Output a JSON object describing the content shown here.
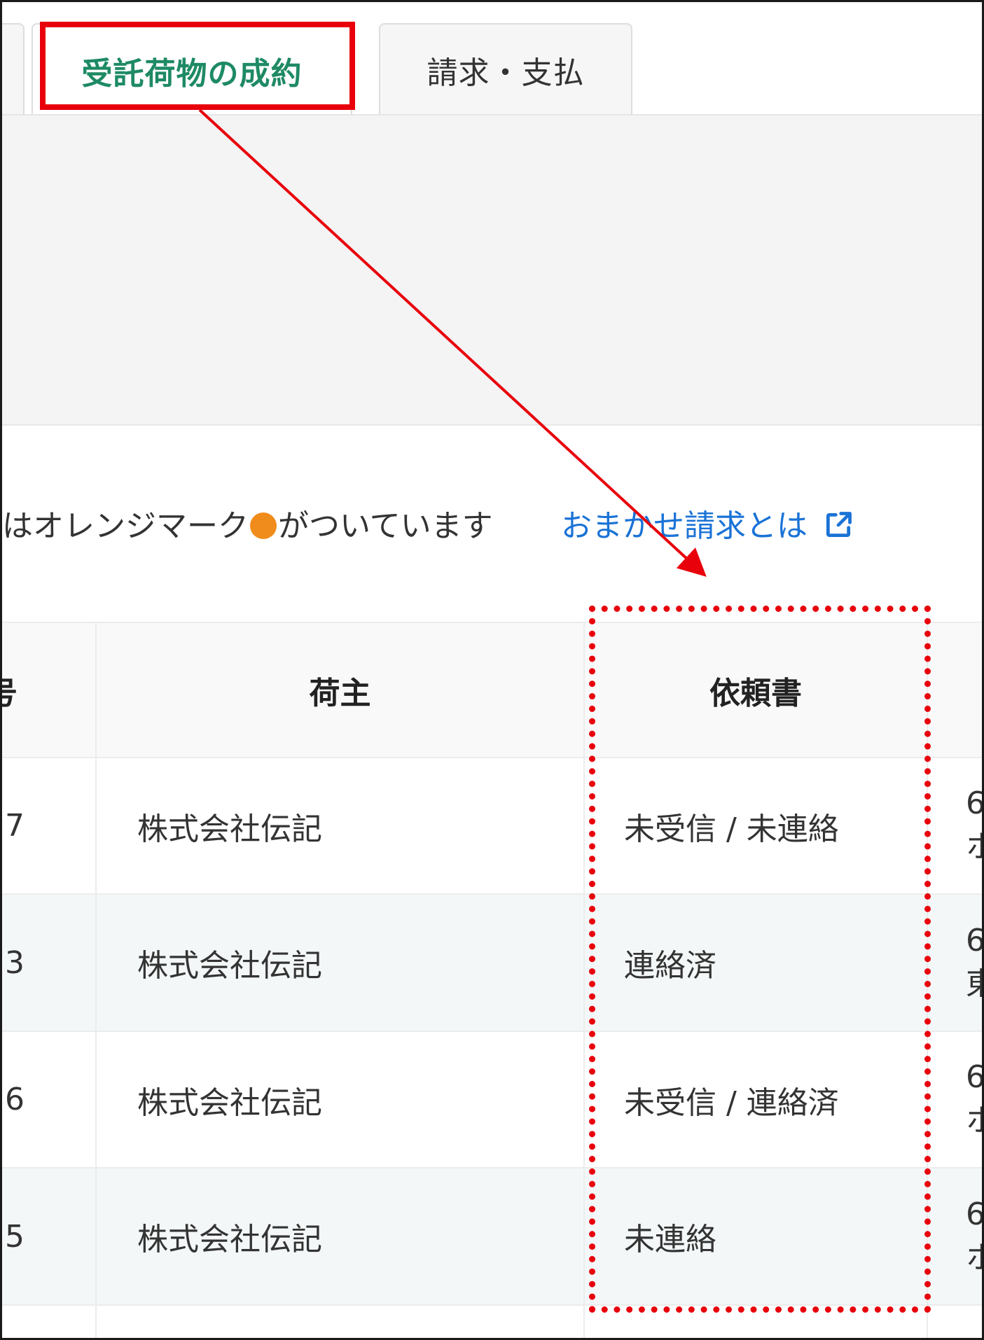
{
  "tabs": [
    {
      "label": "受託荷物の成約",
      "active": true
    },
    {
      "label": "請求・支払",
      "active": false
    }
  ],
  "notice": {
    "text_before": "はオレンジマーク",
    "text_after": "がついています",
    "dot_color": "#f08c1b"
  },
  "help_link": {
    "label": "おまかせ請求とは"
  },
  "table": {
    "headers": {
      "number_partial": "号",
      "shipper": "荷主",
      "request_doc": "依頼書"
    },
    "rows": [
      {
        "number_partial": "7",
        "shipper": "株式会社伝記",
        "request_doc": "未受信 / 未連絡",
        "next_top": "6",
        "next_bottom": "ホ"
      },
      {
        "number_partial": "3",
        "shipper": "株式会社伝記",
        "request_doc": "連絡済",
        "next_top": "6",
        "next_bottom": "東"
      },
      {
        "number_partial": "6",
        "shipper": "株式会社伝記",
        "request_doc": "未受信 / 連絡済",
        "next_top": "6",
        "next_bottom": "ホ"
      },
      {
        "number_partial": "5",
        "shipper": "株式会社伝記",
        "request_doc": "未連絡",
        "next_top": "6",
        "next_bottom": "ホ"
      }
    ]
  },
  "colors": {
    "annotation_red": "#e8000b",
    "active_tab_green": "#1e8a64",
    "link_blue": "#1a73d6"
  }
}
